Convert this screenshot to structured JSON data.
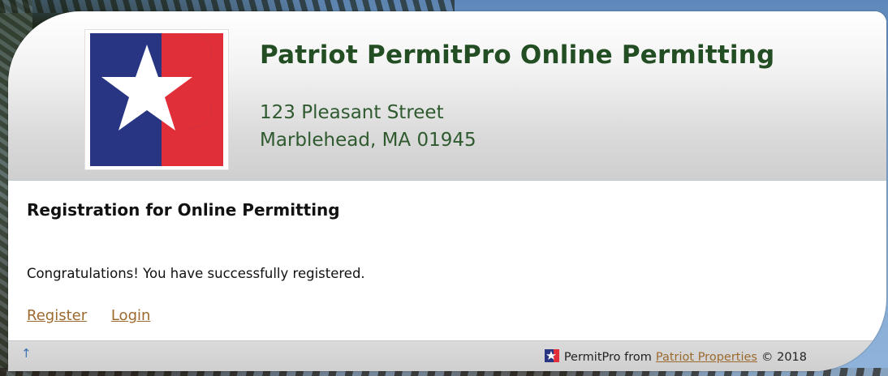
{
  "header": {
    "title": "Patriot PermitPro Online Permitting",
    "address_line1": "123 Pleasant Street",
    "address_line2": "Marblehead, MA 01945",
    "logo_colors": {
      "blue": "#283582",
      "red": "#e12f3a",
      "star": "#ffffff"
    }
  },
  "main": {
    "heading": "Registration for Online Permitting",
    "message": "Congratulations! You have successfully registered.",
    "links": {
      "register": "Register",
      "login": "Login"
    }
  },
  "footer": {
    "up_arrow": "↑",
    "product": "PermitPro from",
    "company_link": "Patriot Properties",
    "copyright": "© 2018"
  },
  "colors": {
    "title_green": "#234e23",
    "link_brown": "#9c6a2e"
  }
}
